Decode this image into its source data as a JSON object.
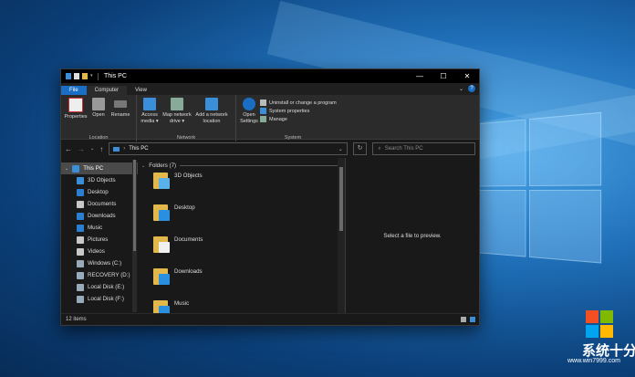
{
  "window": {
    "title": "This PC",
    "minimize_icon": "minimize-icon",
    "maximize_icon": "maximize-icon",
    "close_icon": "close-icon"
  },
  "tabs": {
    "file": "File",
    "computer": "Computer",
    "view": "View"
  },
  "ribbon": {
    "location": {
      "label": "Location",
      "properties": "Properties",
      "open": "Open",
      "rename": "Rename"
    },
    "network": {
      "label": "Network",
      "access_media_1": "Access",
      "access_media_2": "media ▾",
      "map_drive_1": "Map network",
      "map_drive_2": "drive ▾",
      "add_location_1": "Add a network",
      "add_location_2": "location"
    },
    "system": {
      "label": "System",
      "open_settings_1": "Open",
      "open_settings_2": "Settings",
      "uninstall": "Uninstall or change a program",
      "system_properties": "System properties",
      "manage": "Manage"
    }
  },
  "address": {
    "path": "This PC",
    "search_placeholder": "Search This PC"
  },
  "nav_pane": {
    "root": "This PC",
    "items": [
      {
        "label": "3D Objects",
        "icon": "3d-objects-icon",
        "color": "#3a8fd8"
      },
      {
        "label": "Desktop",
        "icon": "desktop-icon",
        "color": "#2a7fd0"
      },
      {
        "label": "Documents",
        "icon": "documents-icon",
        "color": "#c8c8c8"
      },
      {
        "label": "Downloads",
        "icon": "downloads-icon",
        "color": "#2a7fd0"
      },
      {
        "label": "Music",
        "icon": "music-icon",
        "color": "#2a7fd0"
      },
      {
        "label": "Pictures",
        "icon": "pictures-icon",
        "color": "#c8c8c8"
      },
      {
        "label": "Videos",
        "icon": "videos-icon",
        "color": "#c8c8c8"
      },
      {
        "label": "Windows (C:)",
        "icon": "drive-icon",
        "color": "#9ab"
      },
      {
        "label": "RECOVERY (D:)",
        "icon": "drive-icon",
        "color": "#9ab"
      },
      {
        "label": "Local Disk (E:)",
        "icon": "drive-icon",
        "color": "#9ab"
      },
      {
        "label": "Local Disk (F:)",
        "icon": "drive-icon",
        "color": "#9ab"
      }
    ]
  },
  "content": {
    "group_header": "Folders (7)",
    "folders": [
      {
        "label": "3D Objects",
        "overlay": "#5ab0e8"
      },
      {
        "label": "Desktop",
        "overlay": "#2a8fe0"
      },
      {
        "label": "Documents",
        "overlay": "#f0f0f0"
      },
      {
        "label": "Downloads",
        "overlay": "#2a8fe0"
      },
      {
        "label": "Music",
        "overlay": "#2a8fe0"
      }
    ],
    "preview_text": "Select a file to preview."
  },
  "status": {
    "count": "12 items"
  },
  "watermark": {
    "text": "系统十分",
    "url": "www.win7999.com"
  },
  "colors": {
    "accent": "#1a6fc4",
    "window_bg": "#191919",
    "ribbon_bg": "#2b2b2b"
  }
}
